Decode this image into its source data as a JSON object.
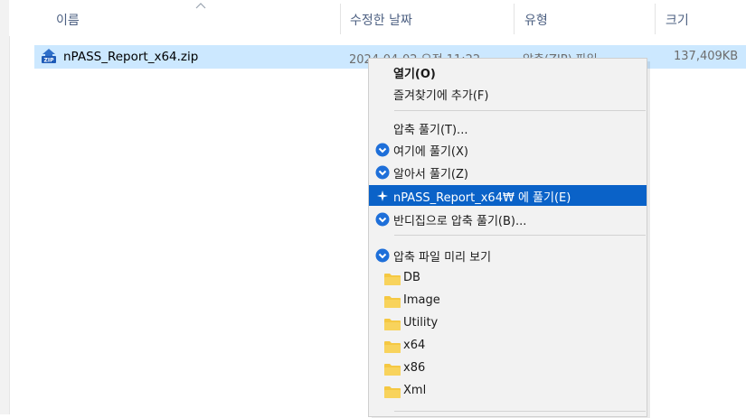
{
  "columns": {
    "name": "이름",
    "date_modified": "수정한 날짜",
    "type": "유형",
    "size": "크기"
  },
  "file": {
    "name": "nPASS_Report_x64.zip",
    "date_modified": "2024-04-02 오전 11:22",
    "type": "압축(ZIP) 파일",
    "size": "137,409KB",
    "icon": "zip-file-icon"
  },
  "context_menu": {
    "open": "열기(O)",
    "add_favorites": "즐겨찾기에 추가(F)",
    "extract": "압축 풀기(T)...",
    "extract_here": "여기에 풀기(X)",
    "extract_smart": "알아서 풀기(Z)",
    "extract_to_folder": "nPASS_Report_x64₩ 에 풀기(E)",
    "extract_bandizip": "반디집으로 압축 풀기(B)...",
    "preview": "압축 파일 미리 보기",
    "preview_folders": [
      "DB",
      "Image",
      "Utility",
      "x64",
      "x86",
      "Xml"
    ]
  },
  "colors": {
    "selection_bg": "#cce8ff",
    "menu_highlight": "#0a62c8",
    "bandizip_blue": "#1e6fd9",
    "folder_yellow": "#f5c842"
  }
}
